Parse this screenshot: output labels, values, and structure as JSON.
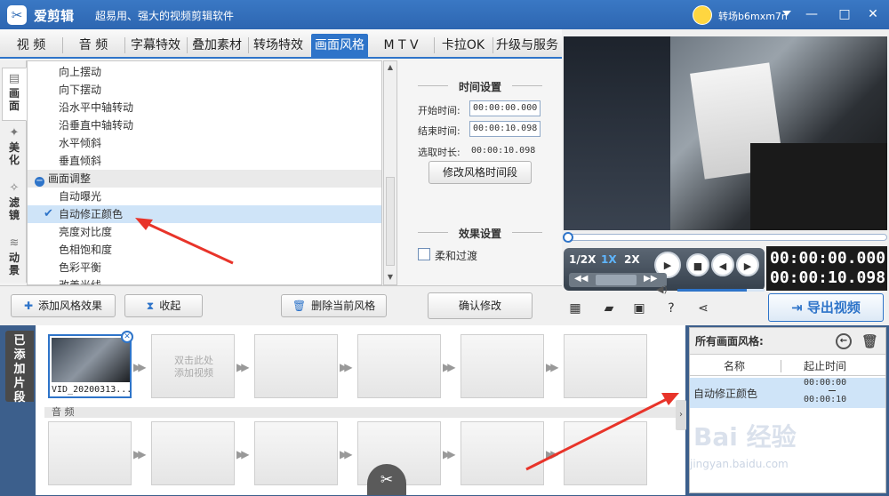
{
  "app": {
    "title": "爱剪辑",
    "slogan": "超易用、强大的视频剪辑软件",
    "username": "转场b6mxm7n",
    "minimize": "—",
    "maximize": "□",
    "close": "✕"
  },
  "tabs": [
    "视 频",
    "音 频",
    "字幕特效",
    "叠加素材",
    "转场特效",
    "画面风格",
    "M T V",
    "卡拉OK",
    "升级与服务"
  ],
  "active_tab": "画面风格",
  "side_tabs": [
    "画 面",
    "美 化",
    "滤 镜",
    "动 景"
  ],
  "effect_list": {
    "items": [
      "向上摆动",
      "向下摆动",
      "沿水平中轴转动",
      "沿垂直中轴转动",
      "水平倾斜",
      "垂直倾斜"
    ],
    "group_label": "画面调整",
    "group_items": [
      "自动曝光",
      "自动修正颜色",
      "亮度对比度",
      "色相饱和度",
      "色彩平衡",
      "改善光线"
    ],
    "selected": "自动修正颜色"
  },
  "time_settings": {
    "heading": "时间设置",
    "start_label": "开始时间:",
    "start_value": "00:00:00.000",
    "end_label": "结束时间:",
    "end_value": "00:00:10.098",
    "duration_label": "选取时长:",
    "duration_value": "00:00:10.098",
    "modify_segment_btn": "修改风格时间段"
  },
  "effect_settings": {
    "heading": "效果设置",
    "smooth_transition": "柔和过渡",
    "smooth_checked": false
  },
  "bottom_buttons": {
    "add_style": "添加风格效果",
    "collapse": "收起",
    "delete_style": "删除当前风格",
    "confirm": "确认修改"
  },
  "player": {
    "speeds": [
      "1/2X",
      "1X",
      "2X"
    ],
    "active_speed": "1X",
    "current_time": "00:00:00.000",
    "total_time": "00:00:10.098",
    "export_label": "导出视频",
    "progress": 0.0,
    "volume": 0.8
  },
  "timeline": {
    "side_label": "已添加片段",
    "clip_name": "VID_20200313...",
    "empty_hint_1": "双击此处",
    "empty_hint_2": "添加视频",
    "audio_label": "音 频"
  },
  "applied_styles": {
    "title": "所有画面风格:",
    "col_name": "名称",
    "col_time": "起止时间",
    "rows": [
      {
        "name": "自动修正颜色",
        "start": "00:00:00",
        "end": "00:00:10"
      }
    ]
  },
  "watermark": {
    "logo": "Bai 经验",
    "url": "jingyan.baidu.com"
  },
  "colors": {
    "accent": "#2e74c9",
    "titlebar": "#3a78c4",
    "selected_row": "#cfe4f8",
    "annotation_arrow": "#e8342a"
  }
}
